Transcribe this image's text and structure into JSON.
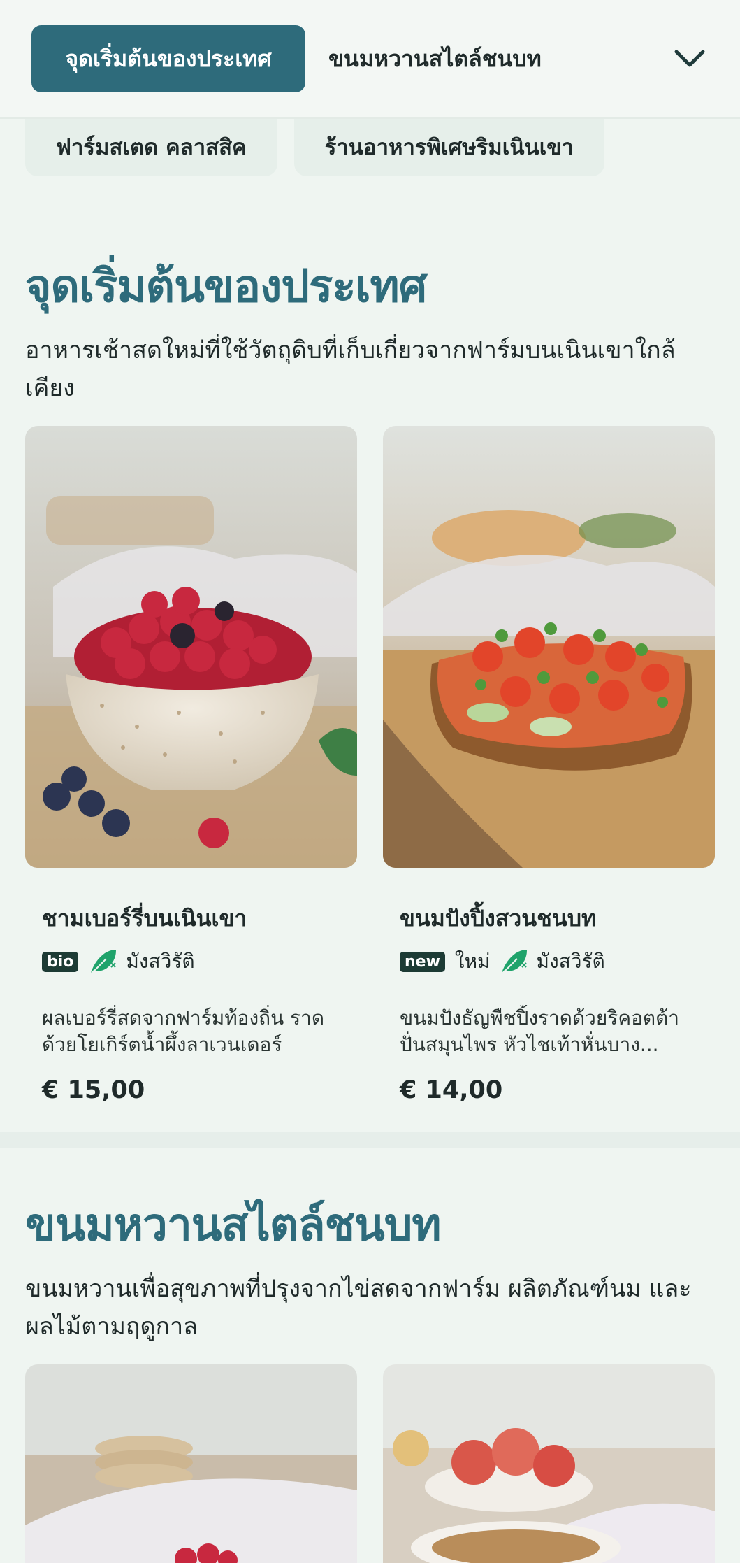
{
  "nav": {
    "active_tab": "จุดเริ่มต้นของประเทศ",
    "tab2": "ขนมหวานสไตล์ชนบท",
    "expand_icon": "chevron-down-icon"
  },
  "chips": [
    "ฟาร์มสเตด คลาสสิค",
    "ร้านอาหารพิเศษริมเนินเขา"
  ],
  "sections": [
    {
      "title": "จุดเริ่มต้นของประเทศ",
      "description": "อาหารเช้าสดใหม่ที่ใช้วัตถุดิบที่เก็บเกี่ยวจากฟาร์มบนเนินเขาใกล้เคียง",
      "items": [
        {
          "name": "ชามเบอร์รี่บนเนินเขา",
          "badge": "bio",
          "diet_icon": "vegetarian-leaf-icon",
          "diet_label": "มังสวิรัติ",
          "description": "ผลเบอร์รี่สดจากฟาร์มท้องถิ่น ราดด้วยโยเกิร์ตน้ำผึ้งลาเวนเดอร์ และ...",
          "price": "€ 15,00"
        },
        {
          "name": "ขนมปังปิ้งสวนชนบท",
          "badge": "new",
          "badge_label": "ใหม่",
          "diet_icon": "vegetarian-leaf-icon",
          "diet_label": "มังสวิรัติ",
          "description": "ขนมปังธัญพืชปิ้งราดด้วยริคอตต้าปั่นสมุนไพร หัวไชเท้าหั่นบาง...",
          "price": "€ 14,00"
        }
      ]
    },
    {
      "title": "ขนมหวานสไตล์ชนบท",
      "description": "ขนมหวานเพื่อสุขภาพที่ปรุงจากไข่สดจากฟาร์ม ผลิตภัณฑ์นม และผลไม้ตามฤดูกาล"
    }
  ],
  "colors": {
    "accent": "#2e6b7b",
    "background": "#eff5f1",
    "leaf": "#1fa36b"
  }
}
